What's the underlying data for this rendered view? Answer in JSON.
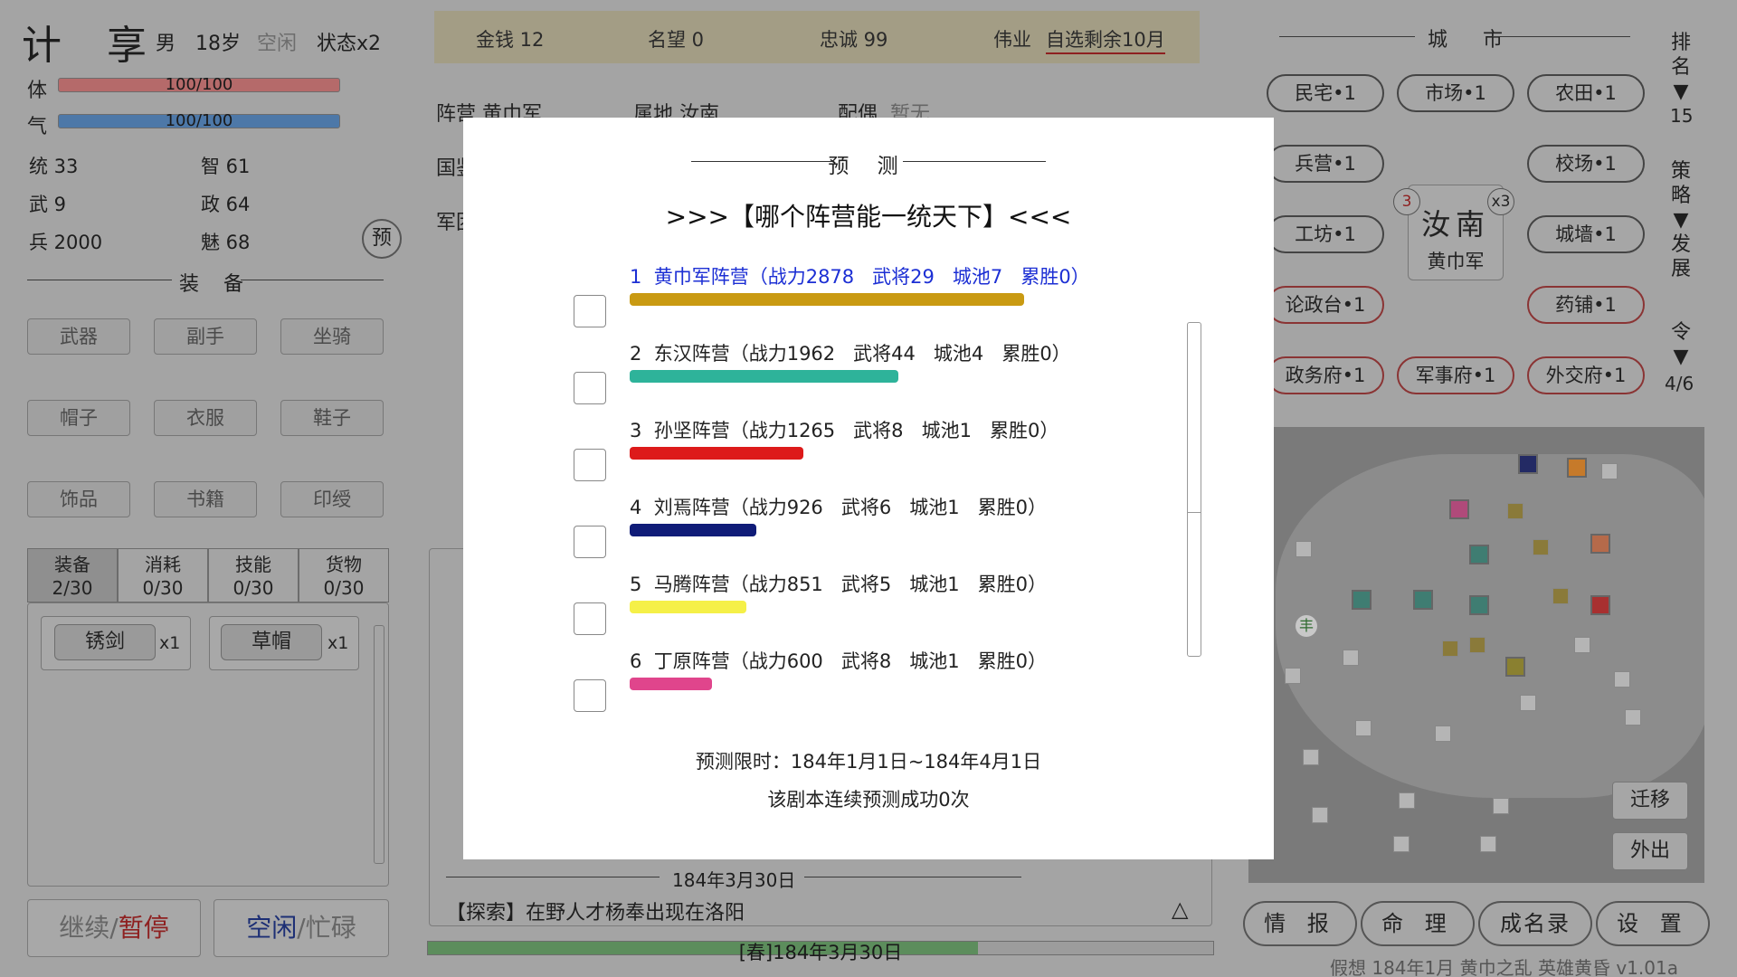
{
  "character": {
    "name": "计 享",
    "gender": "男",
    "age": "18岁",
    "idle": "空闲",
    "status": "状态x2",
    "hp_label": "体",
    "hp_text": "100/100",
    "hp_fraction": 1.0,
    "qi_label": "气",
    "qi_text": "100/100",
    "qi_fraction": 1.0,
    "stats": {
      "tong": "统 33",
      "zhi": "智 61",
      "wu": "武 9",
      "zheng": "政 64",
      "bing": "兵 2000",
      "mei": "魅 68"
    },
    "predict_btn": "预"
  },
  "equipment": {
    "title": "装 备",
    "slots": [
      "武器",
      "副手",
      "坐骑",
      "帽子",
      "衣服",
      "鞋子",
      "饰品",
      "书籍",
      "印绶"
    ]
  },
  "inventory": {
    "tabs": [
      {
        "label": "装备",
        "count": "2/30"
      },
      {
        "label": "消耗",
        "count": "0/30"
      },
      {
        "label": "技能",
        "count": "0/30"
      },
      {
        "label": "货物",
        "count": "0/30"
      }
    ],
    "items": [
      {
        "name": "锈剑",
        "count": "x1"
      },
      {
        "name": "草帽",
        "count": "x1"
      }
    ]
  },
  "controls": {
    "continue": "继续",
    "pause": "暂停",
    "sep": "/",
    "idle": "空闲",
    "busy": "忙碌"
  },
  "topbar": {
    "money": "金钱 12",
    "fame": "名望 0",
    "loyalty": "忠诚 99",
    "feat_label": "伟业",
    "feat_value": "自选剩余10月"
  },
  "info": {
    "faction": "阵营 黄巾军",
    "territory": "属地 汝南",
    "spouse_label": "配偶",
    "spouse_value": "暂无",
    "row2": "国鉴",
    "row3": "军团"
  },
  "log": {
    "date_line": "184年3月30日",
    "entry_tag": "【探索】",
    "entry_text": "在野人才杨奉出现在洛阳",
    "expand_icon": "△",
    "progress_text": "[春]184年3月30日",
    "progress_fraction": 0.7
  },
  "city": {
    "title": "城 市",
    "buildings": [
      {
        "label": "民宅•1",
        "red": false
      },
      {
        "label": "市场•1",
        "red": false
      },
      {
        "label": "农田•1",
        "red": false
      },
      {
        "label": "兵营•1",
        "red": false
      },
      {
        "label": "校场•1",
        "red": false
      },
      {
        "label": "工坊•1",
        "red": false
      },
      {
        "label": "城墙•1",
        "red": false
      },
      {
        "label": "论政台•1",
        "red": true
      },
      {
        "label": "药铺•1",
        "red": true
      },
      {
        "label": "政务府•1",
        "red": true
      },
      {
        "label": "军事府•1",
        "red": true
      },
      {
        "label": "外交府•1",
        "red": true
      }
    ],
    "card_name": "汝南",
    "card_faction": "黄巾军",
    "badge_left": "3",
    "badge_right": "x3"
  },
  "side": {
    "rank": "排\n名\n▼",
    "rank_value": "15",
    "strategy": "策\n略\n▼\n发\n展",
    "order": "令\n▼",
    "order_value": "4/6"
  },
  "map": {
    "migrate": "迁移",
    "go_out": "外出",
    "marker_char": "丰"
  },
  "bottom_nav": [
    "情 报",
    "命 理",
    "成名录",
    "设 置"
  ],
  "footer": "假想 184年1月 黄巾之乱  英雄黄昏 v1.01a",
  "modal": {
    "title": "预 测",
    "question": ">>>【哪个阵营能一统天下】<<<",
    "factions": [
      {
        "rank": "1",
        "name": "黄巾军阵营",
        "power": 2878,
        "generals": 29,
        "cities": 7,
        "wins": 0,
        "color": "#c99a12"
      },
      {
        "rank": "2",
        "name": "东汉阵营",
        "power": 1962,
        "generals": 44,
        "cities": 4,
        "wins": 0,
        "color": "#2eb39a"
      },
      {
        "rank": "3",
        "name": "孙坚阵营",
        "power": 1265,
        "generals": 8,
        "cities": 1,
        "wins": 0,
        "color": "#dd1a1a"
      },
      {
        "rank": "4",
        "name": "刘焉阵营",
        "power": 926,
        "generals": 6,
        "cities": 1,
        "wins": 0,
        "color": "#101c78"
      },
      {
        "rank": "5",
        "name": "马腾阵营",
        "power": 851,
        "generals": 5,
        "cities": 1,
        "wins": 0,
        "color": "#f5f048"
      },
      {
        "rank": "6",
        "name": "丁原阵营",
        "power": 600,
        "generals": 8,
        "cities": 1,
        "wins": 0,
        "color": "#e0458c"
      }
    ],
    "labels": [
      "1  黄巾军阵营（战力2878   武将29   城池7   累胜0）",
      "2  东汉阵营（战力1962   武将44   城池4   累胜0）",
      "3  孙坚阵营（战力1265   武将8   城池1   累胜0）",
      "4  刘焉阵营（战力926   武将6   城池1   累胜0）",
      "5  马腾阵营（战力851   武将5   城池1   累胜0）",
      "6  丁原阵营（战力600   武将8   城池1   累胜0）"
    ],
    "time_limit": "预测限时：184年1月1日~184年4月1日",
    "streak": "该剧本连续预测成功0次"
  }
}
